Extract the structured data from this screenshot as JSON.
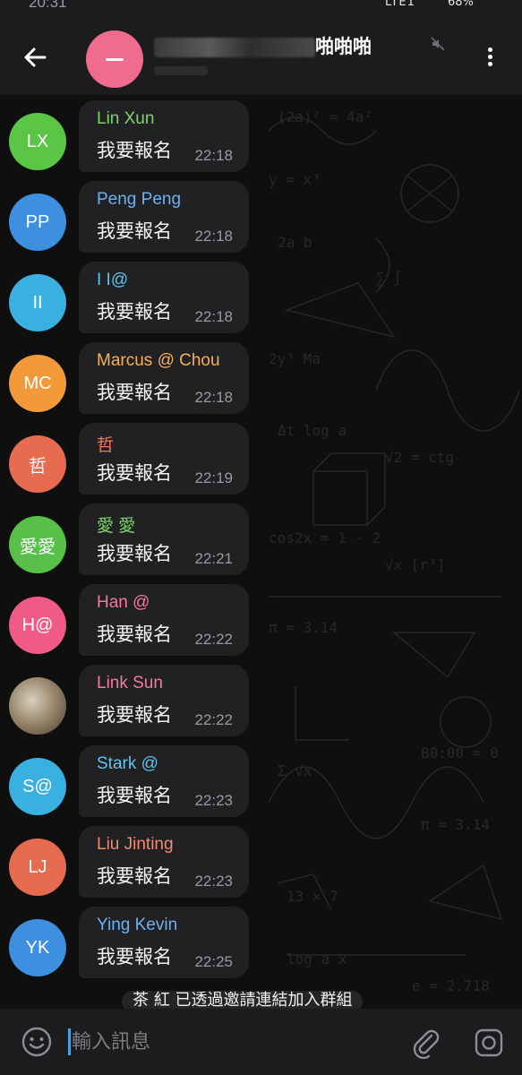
{
  "status_bar": {
    "time": "20:31",
    "signal": "LTE1",
    "battery": "68%"
  },
  "header": {
    "title_suffix": "啪啪啪",
    "back_icon": "arrow-left-icon",
    "menu_icon": "kebab-menu-icon",
    "mute_icon": "muted-speaker-icon"
  },
  "messages": [
    {
      "sender": "Lin Xun",
      "initials": "LX",
      "text": "我要報名",
      "time": "22:18",
      "avatar_color": "#5bc546",
      "name_color": "#7ed36a"
    },
    {
      "sender": "Peng Peng",
      "initials": "PP",
      "text": "我要報名",
      "time": "22:18",
      "avatar_color": "#3d8fe0",
      "name_color": "#6ab2f2"
    },
    {
      "sender": "I I@",
      "initials": "II",
      "text": "我要報名",
      "time": "22:18",
      "avatar_color": "#3ab0e0",
      "name_color": "#5fc4ee"
    },
    {
      "sender": "Marcus @ Chou",
      "initials": "MC",
      "text": "我要報名",
      "time": "22:18",
      "avatar_color": "#f2993a",
      "name_color": "#f5b05c"
    },
    {
      "sender": "哲",
      "initials": "哲",
      "text": "我要報名",
      "time": "22:19",
      "avatar_color": "#e66b4f",
      "name_color": "#f07a5e"
    },
    {
      "sender": "愛 愛",
      "initials": "愛愛",
      "text": "我要報名",
      "time": "22:21",
      "avatar_color": "#58c04a",
      "name_color": "#7ed36a"
    },
    {
      "sender": "Han @",
      "initials": "H@",
      "text": "我要報名",
      "time": "22:22",
      "avatar_color": "#ef5b86",
      "name_color": "#f27a9c"
    },
    {
      "sender": "Link Sun",
      "initials": "",
      "text": "我要報名",
      "time": "22:22",
      "avatar_color": "#8a7a64",
      "name_color": "#f27a9c"
    },
    {
      "sender": "Stark @",
      "initials": "S@",
      "text": "我要報名",
      "time": "22:23",
      "avatar_color": "#3ab0e0",
      "name_color": "#5fc4ee"
    },
    {
      "sender": "Liu Jinting",
      "initials": "LJ",
      "text": "我要報名",
      "time": "22:23",
      "avatar_color": "#e66b4f",
      "name_color": "#f08a70"
    },
    {
      "sender": "Ying Kevin",
      "initials": "YK",
      "text": "我要報名",
      "time": "22:25",
      "avatar_color": "#3d8fe0",
      "name_color": "#6ab2f2"
    }
  ],
  "system_notice": "茶 紅 已透過邀請連結加入群組",
  "input_bar": {
    "placeholder": "輸入訊息",
    "emoji_icon": "smiley-icon",
    "attach_icon": "paperclip-icon",
    "camera_icon": "camera-icon"
  },
  "colors": {
    "accent": "#4ea1e0",
    "bubble": "#212123",
    "header_bg": "#1c1c1e"
  }
}
